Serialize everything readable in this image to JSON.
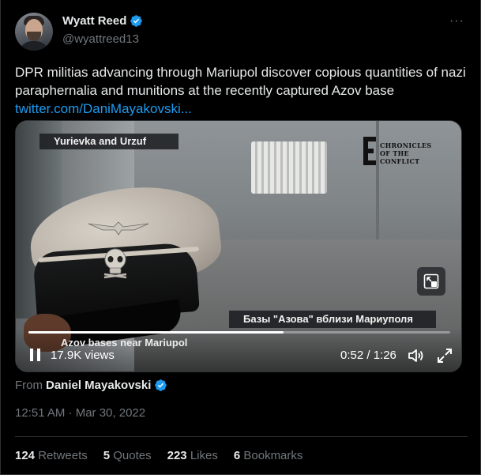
{
  "author": {
    "display_name": "Wyatt Reed",
    "handle": "@wyattreed13",
    "verified": true
  },
  "tweet": {
    "text": "DPR militias advancing through Mariupol discover copious quantities of nazi paraphernalia and munitions at the recently captured Azov base",
    "link": "twitter.com/DaniMayakovski..."
  },
  "media": {
    "caption_top": "Yurievka and Urzuf",
    "watermark_line1": "CHRONICLES",
    "watermark_line2": "OF THE CONFLICT",
    "caption_russian": "Базы \"Азова\" вблизи Мариуполя",
    "caption_english": "Azov bases near Mariupol",
    "views": "17.9K views",
    "time": "0:52 / 1:26",
    "progress": 0.605
  },
  "source": {
    "from_label": "From",
    "name": "Daniel Mayakovski",
    "verified": true
  },
  "timestamp": "12:51 AM · Mar 30, 2022",
  "stats": {
    "retweets_count": "124",
    "retweets_label": "Retweets",
    "quotes_count": "5",
    "quotes_label": "Quotes",
    "likes_count": "223",
    "likes_label": "Likes",
    "bookmarks_count": "6",
    "bookmarks_label": "Bookmarks"
  },
  "colors": {
    "accent": "#1d9bf0",
    "muted": "#71767b",
    "text": "#e7e9ea",
    "background": "#000000"
  },
  "icons": [
    "verified-badge-icon",
    "more-options-icon",
    "pause-icon",
    "volume-icon",
    "fullscreen-icon",
    "picture-in-picture-icon"
  ]
}
